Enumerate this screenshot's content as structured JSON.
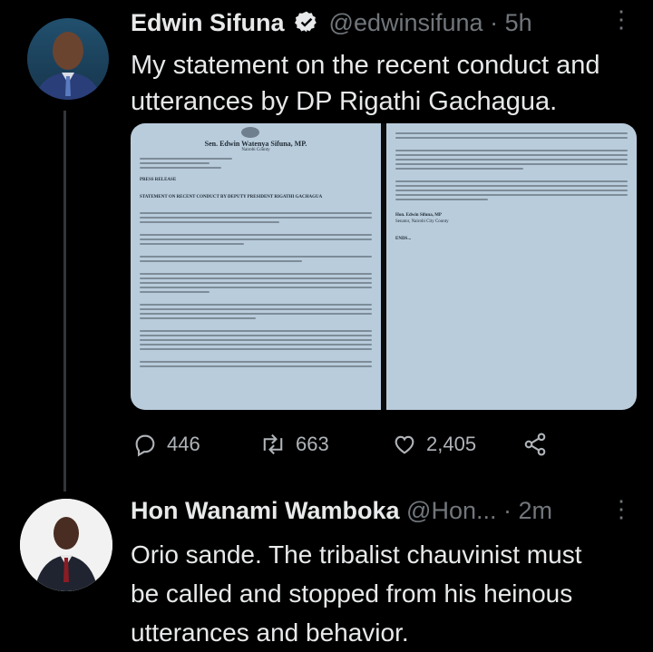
{
  "tweet1": {
    "name": "Edwin Sifuna",
    "handle": "@edwinsifuna",
    "time": "· 5h",
    "text": "My statement on the recent conduct and utterances by DP Rigathi Gachagua.",
    "document": {
      "sender": "Sen. Edwin Watenya Sifuna, MP.",
      "county": "Nairobi County",
      "heading": "PRESS RELEASE",
      "statement_title": "STATEMENT ON RECENT CONDUCT BY DEPUTY PRESIDENT RIGATHI GACHAGUA",
      "signature": "Hon. Edwin Sifuna, MP",
      "signature_role": "Senator, Nairobi City County",
      "ends": "ENDS..."
    },
    "stats": {
      "replies": "446",
      "retweets": "663",
      "likes": "2,405"
    }
  },
  "tweet2": {
    "name": "Hon Wanami Wamboka",
    "handle": "@Hon...",
    "time": "· 2m",
    "text_lines": [
      "Orio sande. The tribalist chauvinist must",
      "be called and stopped from his heinous",
      "utterances and behavior."
    ]
  },
  "colors": {
    "background": "#000000",
    "text": "#e7e9ea",
    "muted": "#71767b",
    "thread": "#333639",
    "verified": "#e7e9ea"
  },
  "icons": [
    "verified-icon",
    "more-icon",
    "reply-icon",
    "retweet-icon",
    "like-icon",
    "share-icon"
  ]
}
